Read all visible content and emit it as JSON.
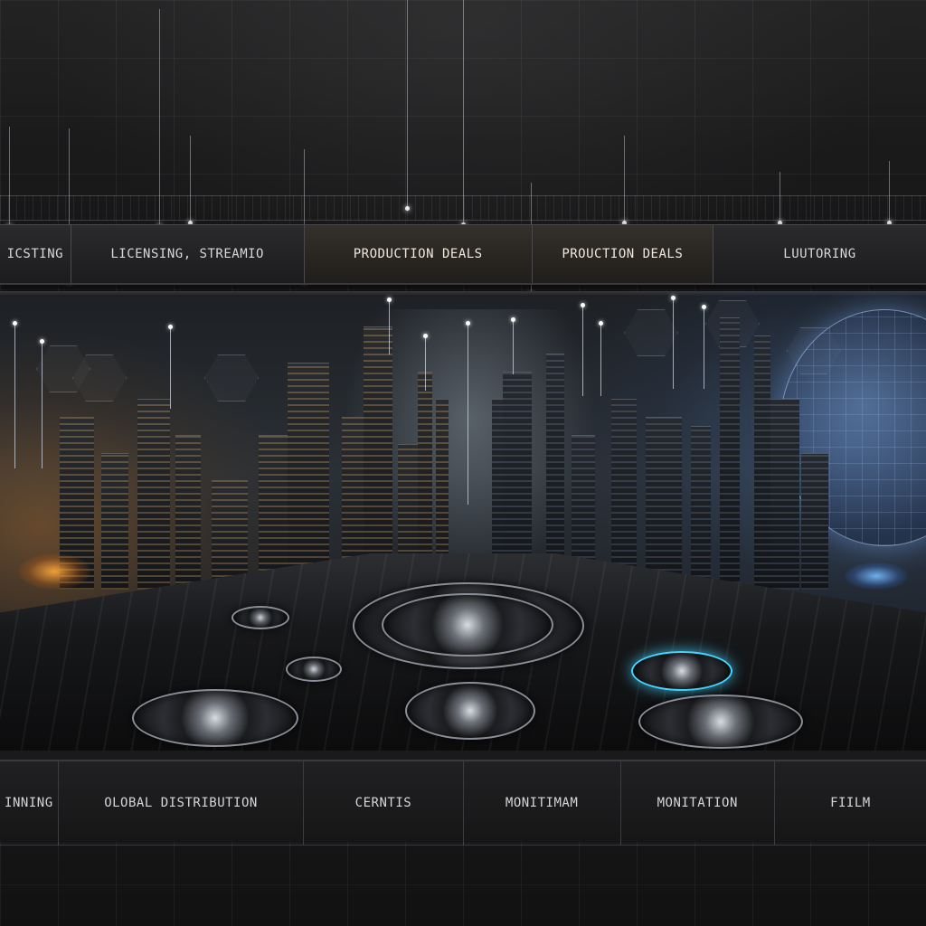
{
  "top_nav": {
    "tabs": [
      {
        "label": "ICSTING"
      },
      {
        "label": "LICENSING, STREAMIO"
      },
      {
        "label": "PRODUCTION  DEALS"
      },
      {
        "label": "PROUCTION DEALS"
      },
      {
        "label": "LUUTORING"
      }
    ]
  },
  "bottom_nav": {
    "tabs": [
      {
        "label": "INNING"
      },
      {
        "label": "OLOBAL DISTRIBUTION"
      },
      {
        "label": "CERNTIS"
      },
      {
        "label": "MONITIMAM"
      },
      {
        "label": "MONITATION"
      },
      {
        "label": "FIILM"
      }
    ]
  },
  "colors": {
    "background": "#121213",
    "panel": "#1c1c1e",
    "text": "#d8d8dc",
    "warm_accent": "#c07a2a",
    "cool_accent": "#6a9ad8",
    "cyan_accent": "#44d6ff"
  }
}
